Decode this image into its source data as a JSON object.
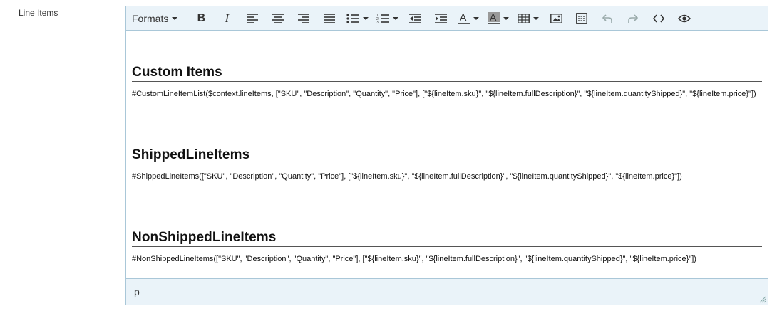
{
  "field": {
    "label": "Line Items"
  },
  "toolbar": {
    "formats_label": "Formats",
    "icons": [
      "bold-icon",
      "italic-icon",
      "align-left-icon",
      "align-center-icon",
      "align-right-icon",
      "align-justify-icon",
      "bullet-list-icon",
      "numbered-list-icon",
      "outdent-icon",
      "indent-icon",
      "text-color-icon",
      "background-color-icon",
      "table-icon",
      "image-icon",
      "template-icon",
      "undo-icon",
      "redo-icon",
      "source-code-icon",
      "preview-icon"
    ]
  },
  "content": {
    "sections": [
      {
        "heading": "Custom Items",
        "body": "#CustomLineItemList($context.lineItems, [\"SKU\", \"Description\", \"Quantity\", \"Price\"], [\"${lineItem.sku}\", \"${lineItem.fullDescription}\", \"${lineItem.quantityShipped}\", \"${lineItem.price}\"])"
      },
      {
        "heading": "ShippedLineItems",
        "body": "#ShippedLineItems([\"SKU\", \"Description\", \"Quantity\", \"Price\"], [\"${lineItem.sku}\", \"${lineItem.fullDescription}\", \"${lineItem.quantityShipped}\", \"${lineItem.price}\"])"
      },
      {
        "heading": "NonShippedLineItems",
        "body": "#NonShippedLineItems([\"SKU\", \"Description\", \"Quantity\", \"Price\"], [\"${lineItem.sku}\", \"${lineItem.fullDescription}\", \"${lineItem.quantityShipped}\", \"${lineItem.price}\"])"
      }
    ]
  },
  "statusbar": {
    "path": "p"
  },
  "colors": {
    "toolbar_bg": "#eaf3f9",
    "border": "#a9c7d8",
    "disabled_icon": "#9aa"
  }
}
